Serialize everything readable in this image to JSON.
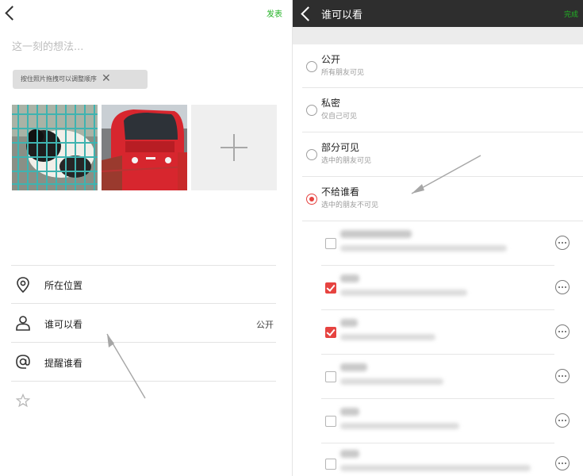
{
  "left": {
    "publish_label": "发表",
    "placeholder": "这一刻的想法...",
    "tip_text": "按住照片拖拽可以调整顺序",
    "tip_close": "✕",
    "menu": [
      {
        "icon": "location-pin-icon",
        "label": "所在位置",
        "value": ""
      },
      {
        "icon": "person-icon",
        "label": "谁可以看",
        "value": "公开"
      },
      {
        "icon": "at-sign-icon",
        "label": "提醒谁看",
        "value": ""
      }
    ]
  },
  "right": {
    "title": "谁可以看",
    "done_label": "完成",
    "options": [
      {
        "title": "公开",
        "subtitle": "所有朋友可见",
        "selected": false
      },
      {
        "title": "私密",
        "subtitle": "仅自己可见",
        "selected": false
      },
      {
        "title": "部分可见",
        "subtitle": "选中的朋友可见",
        "selected": false
      },
      {
        "title": "不给谁看",
        "subtitle": "选中的朋友不可见",
        "selected": true
      }
    ],
    "groups": [
      {
        "checked": false
      },
      {
        "checked": true
      },
      {
        "checked": true
      },
      {
        "checked": false
      },
      {
        "checked": false
      },
      {
        "checked": false
      }
    ]
  },
  "colors": {
    "accent_green": "#21b224",
    "select_red": "#e64340",
    "topbar": "#2e2e2e"
  }
}
